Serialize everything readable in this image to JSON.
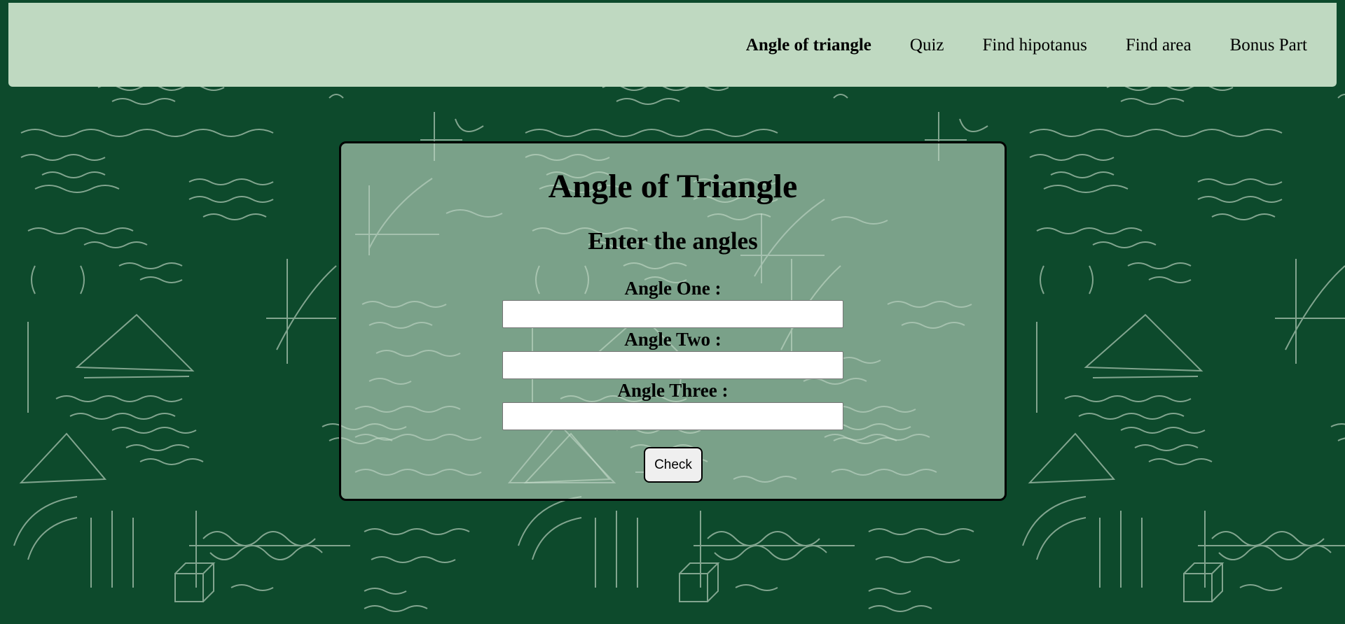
{
  "nav": {
    "items": [
      {
        "label": "Angle of triangle",
        "active": true
      },
      {
        "label": "Quiz",
        "active": false
      },
      {
        "label": "Find hipotanus",
        "active": false
      },
      {
        "label": "Find area",
        "active": false
      },
      {
        "label": "Bonus Part",
        "active": false
      }
    ]
  },
  "panel": {
    "title": "Angle of Triangle",
    "subtitle": "Enter the angles",
    "fields": [
      {
        "label": "Angle One :",
        "value": ""
      },
      {
        "label": "Angle Two :",
        "value": ""
      },
      {
        "label": "Angle Three :",
        "value": ""
      }
    ],
    "button_label": "Check"
  },
  "colors": {
    "background": "#0d4a2c",
    "navbar": "#bfd9c1",
    "panel": "#8fb295"
  },
  "background_image": {
    "description_icon": "chalkboard-math-pattern"
  }
}
